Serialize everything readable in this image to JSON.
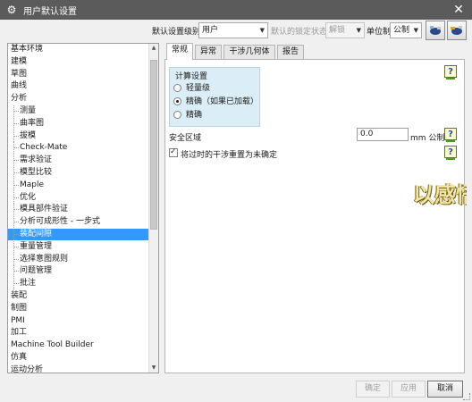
{
  "window": {
    "title": "用户默认设置",
    "close_glyph": "✕"
  },
  "toolbar": {
    "level_label": "默认设置级别",
    "level_value": "用户",
    "lock_label": "默认的锁定状态",
    "lock_value": "解锁",
    "unit_label": "单位制",
    "unit_value": "公制",
    "icons": [
      "tool-icon-1",
      "tool-icon-2"
    ]
  },
  "tree": {
    "items": [
      {
        "label": "基本环境",
        "level": 0
      },
      {
        "label": "建模",
        "level": 0
      },
      {
        "label": "草图",
        "level": 0
      },
      {
        "label": "曲线",
        "level": 0
      },
      {
        "label": "分析",
        "level": 0
      },
      {
        "label": "测量",
        "level": 1
      },
      {
        "label": "曲率图",
        "level": 1
      },
      {
        "label": "拔模",
        "level": 1
      },
      {
        "label": "Check-Mate",
        "level": 1
      },
      {
        "label": "需求验证",
        "level": 1
      },
      {
        "label": "模型比较",
        "level": 1
      },
      {
        "label": "Maple",
        "level": 1
      },
      {
        "label": "优化",
        "level": 1
      },
      {
        "label": "模具部件验证",
        "level": 1
      },
      {
        "label": "分析可成形性 - 一步式",
        "level": 1
      },
      {
        "label": "装配间隙",
        "level": 1,
        "selected": true
      },
      {
        "label": "重量管理",
        "level": 1
      },
      {
        "label": "选择意图规则",
        "level": 1
      },
      {
        "label": "问题管理",
        "level": 1
      },
      {
        "label": "批注",
        "level": 1
      },
      {
        "label": "装配",
        "level": 0
      },
      {
        "label": "制图",
        "level": 0
      },
      {
        "label": "PMI",
        "level": 0
      },
      {
        "label": "加工",
        "level": 0
      },
      {
        "label": "Machine Tool Builder",
        "level": 0
      },
      {
        "label": "仿真",
        "level": 0
      },
      {
        "label": "运动分析",
        "level": 0
      }
    ]
  },
  "tabs": [
    {
      "label": "常规",
      "active": true
    },
    {
      "label": "异常",
      "active": false
    },
    {
      "label": "干涉几何体",
      "active": false
    },
    {
      "label": "报告",
      "active": false
    }
  ],
  "calc_group": {
    "title": "计算设置",
    "options": [
      {
        "label": "轻量级",
        "selected": false
      },
      {
        "label": "精确（如果已加载）",
        "selected": true
      },
      {
        "label": "精确",
        "selected": false
      }
    ]
  },
  "safety_zone": {
    "label": "安全区域",
    "value": "0.0",
    "unit": "mm 公制"
  },
  "obsolete_checkbox": {
    "label": "将过时的干涉重置为未确定",
    "checked": true
  },
  "help_glyph": "?",
  "overlay": {
    "text": "以感悟"
  },
  "buttons": {
    "ok": "确定",
    "apply": "应用",
    "cancel": "取消"
  },
  "colors": {
    "selection": "#3399ff",
    "titlebar": "#5b5b5b",
    "group_bg": "#dbeef7"
  }
}
